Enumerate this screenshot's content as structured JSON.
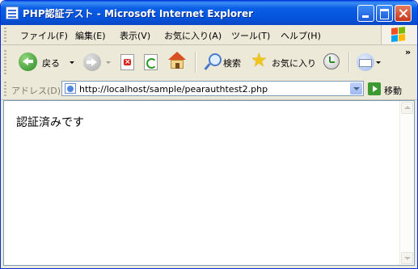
{
  "window": {
    "title": "PHP認証テスト - Microsoft Internet Explorer"
  },
  "menu": {
    "items": [
      {
        "label": "ファイル(F)"
      },
      {
        "label": "編集(E)"
      },
      {
        "label": "表示(V)"
      },
      {
        "label": "お気に入り(A)"
      },
      {
        "label": "ツール(T)"
      },
      {
        "label": "ヘルプ(H)"
      }
    ]
  },
  "toolbar": {
    "back_label": "戻る",
    "search_label": "検索",
    "favorites_label": "お気に入り",
    "overflow": "»"
  },
  "address": {
    "label": "アドレス(D)",
    "url": "http://localhost/sample/pearauthtest2.php",
    "go_label": "移動"
  },
  "content": {
    "message": "認証済みです"
  },
  "colors": {
    "titlebar": "#0a5fe6",
    "chrome": "#ece9d8",
    "back_button": "#3c9a31"
  }
}
